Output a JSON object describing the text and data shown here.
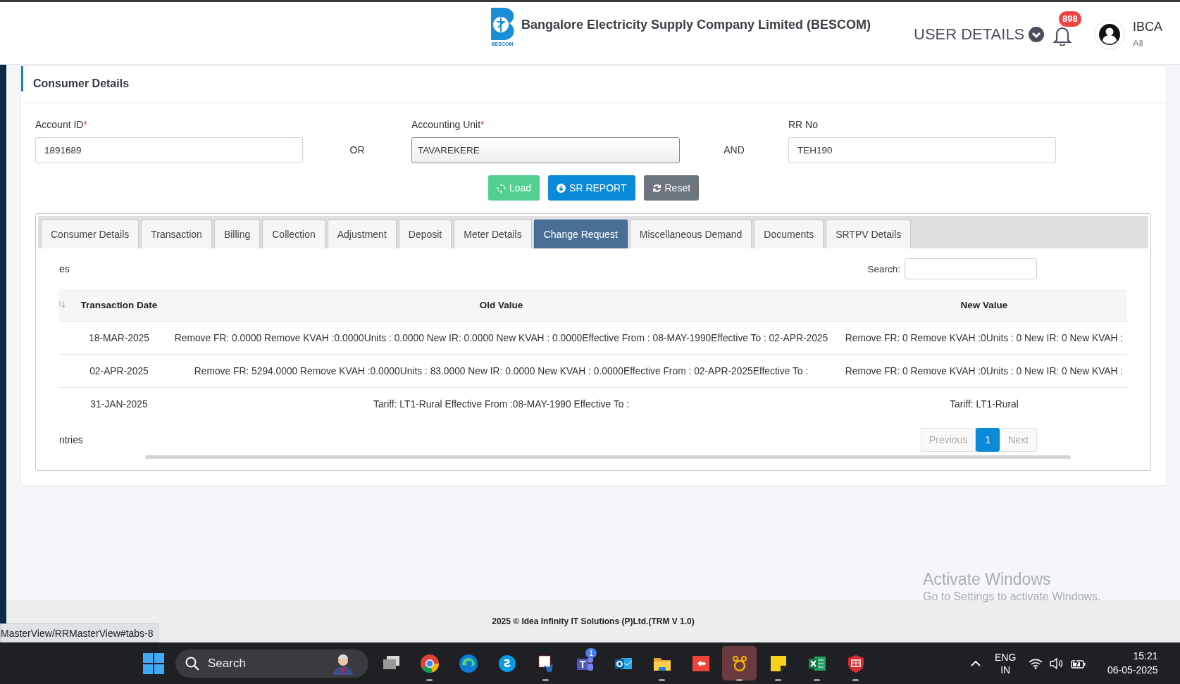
{
  "header": {
    "logo_caption": "BESCOM",
    "org_title": "Bangalore Electricity Supply Company Limited (BESCOM)",
    "user_details": "USER DETAILS",
    "notification_count": "898",
    "user_name": "IBCA",
    "user_role": "All"
  },
  "card": {
    "title": "Consumer Details",
    "fields": [
      {
        "label": "Account ID",
        "required_mark": "*",
        "value": "1891689",
        "kind": "text"
      },
      {
        "label": "Accounting Unit",
        "required_mark": "*",
        "value": "TAVAREKERE",
        "kind": "select"
      },
      {
        "label": "RR No",
        "value": "TEH190",
        "kind": "text"
      }
    ],
    "connectors": [
      "OR",
      "AND"
    ],
    "buttons": [
      {
        "label": "Load",
        "kind": "load"
      },
      {
        "label": "SR REPORT",
        "kind": "report"
      },
      {
        "label": "Reset",
        "kind": "reset"
      }
    ]
  },
  "tabs": [
    {
      "label": "Consumer Details",
      "selected": false
    },
    {
      "label": "Transaction",
      "selected": false
    },
    {
      "label": "Billing",
      "selected": false
    },
    {
      "label": "Collection",
      "selected": false
    },
    {
      "label": "Adjustment",
      "selected": false
    },
    {
      "label": "Deposit",
      "selected": false
    },
    {
      "label": "Meter Details",
      "selected": false
    },
    {
      "label": "Change Request",
      "selected": true
    },
    {
      "label": "Miscellaneous Demand",
      "selected": false
    },
    {
      "label": "Documents",
      "selected": false
    },
    {
      "label": "SRTPV Details",
      "selected": false
    }
  ],
  "table": {
    "length_label": "es",
    "search_label": "Search:",
    "columns": [
      "Transaction Date",
      "Old Value",
      "New Value"
    ],
    "rows": [
      {
        "date": "18-MAR-2025",
        "old_value": "Remove FR: 0.0000 Remove KVAH :0.0000Units : 0.0000 New IR: 0.0000 New KVAH : 0.0000Effective From : 08-MAY-1990Effective To : 02-APR-2025",
        "new_value": "Remove FR: 0 Remove KVAH :0Units : 0 New IR: 0 New KVAH :"
      },
      {
        "date": "02-APR-2025",
        "old_value": "Remove FR: 5294.0000 Remove KVAH :0.0000Units : 83.0000 New IR: 0.0000 New KVAH : 0.0000Effective From : 02-APR-2025Effective To :",
        "new_value": "Remove FR: 0 Remove KVAH :0Units : 0 New IR: 0 New KVAH :"
      },
      {
        "date": "31-JAN-2025",
        "old_value": "Tariff: LT1-Rural Effective From :08-MAY-1990 Effective To :",
        "new_value": "Tariff: LT1-Rural"
      }
    ],
    "info": "ntries",
    "pagination": {
      "previous": "Previous",
      "next": "Next",
      "pages": [
        {
          "label": "1",
          "selected": true
        }
      ]
    }
  },
  "footer": "2025 © Idea Infinity IT Solutions (P)Ltd.(TRM V 1.0)",
  "status_url": "MasterView/RRMasterView#tabs-8",
  "activation_notice": {
    "title": "Activate Windows",
    "subtitle": "Go to Settings to activate Windows."
  },
  "taskbar": {
    "search_placeholder": "Search",
    "apps": [
      {
        "kind": "taskview",
        "running": false,
        "selected": false
      },
      {
        "kind": "chrome",
        "running": true,
        "selected": false
      },
      {
        "kind": "edge",
        "running": false,
        "selected": false
      },
      {
        "kind": "skype",
        "running": false,
        "selected": false
      },
      {
        "kind": "snip",
        "running": true,
        "selected": false
      },
      {
        "kind": "teams",
        "running": false,
        "selected": false,
        "badge": "1"
      },
      {
        "kind": "outlook",
        "running": false,
        "selected": false
      },
      {
        "kind": "explorer",
        "running": true,
        "selected": false
      },
      {
        "kind": "anydesk",
        "running": false,
        "selected": false
      },
      {
        "kind": "paw",
        "running": true,
        "selected": true
      },
      {
        "kind": "sticky",
        "running": true,
        "selected": false
      },
      {
        "kind": "excel",
        "running": true,
        "selected": false
      },
      {
        "kind": "shield",
        "running": true,
        "selected": false
      }
    ],
    "language": "ENG",
    "region": "IN",
    "time": "15:21",
    "date": "06-05-2025"
  }
}
